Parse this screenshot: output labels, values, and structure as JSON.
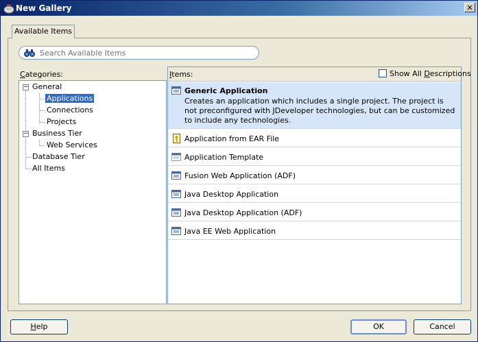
{
  "window": {
    "title": "New Gallery"
  },
  "tabs": [
    {
      "label": "Available Items"
    }
  ],
  "search": {
    "placeholder": "Search Available Items"
  },
  "categories": {
    "label": "Categories:",
    "tree": [
      {
        "label": "General",
        "expanded": true
      },
      {
        "label": "Applications",
        "selected": true
      },
      {
        "label": "Connections"
      },
      {
        "label": "Projects"
      },
      {
        "label": "Business Tier",
        "expanded": true
      },
      {
        "label": "Web Services"
      },
      {
        "label": "Database Tier"
      },
      {
        "label": "All Items"
      }
    ]
  },
  "items": {
    "label": "Items:",
    "show_all_label": "Show All Descriptions",
    "show_all_checked": false,
    "list": [
      {
        "label": "Generic Application",
        "selected": true,
        "icon": "application-icon",
        "description": "Creates an application which includes a single project. The project is not preconfigured with JDeveloper technologies, but can be customized to include any technologies."
      },
      {
        "label": "Application from EAR File",
        "icon": "ear-file-icon"
      },
      {
        "label": "Application Template",
        "icon": "template-icon"
      },
      {
        "label": "Fusion Web Application (ADF)",
        "icon": "application-icon"
      },
      {
        "label": "Java Desktop Application",
        "icon": "application-icon"
      },
      {
        "label": "Java Desktop Application (ADF)",
        "icon": "application-icon"
      },
      {
        "label": "Java EE Web Application",
        "icon": "application-icon"
      }
    ]
  },
  "buttons": {
    "help": "Help",
    "ok": "OK",
    "cancel": "Cancel"
  },
  "colors": {
    "title_bar": "#0a246a",
    "selection": "#316ac5",
    "item_selection": "#d6e6f8",
    "dialog_bg": "#ece9d8"
  }
}
